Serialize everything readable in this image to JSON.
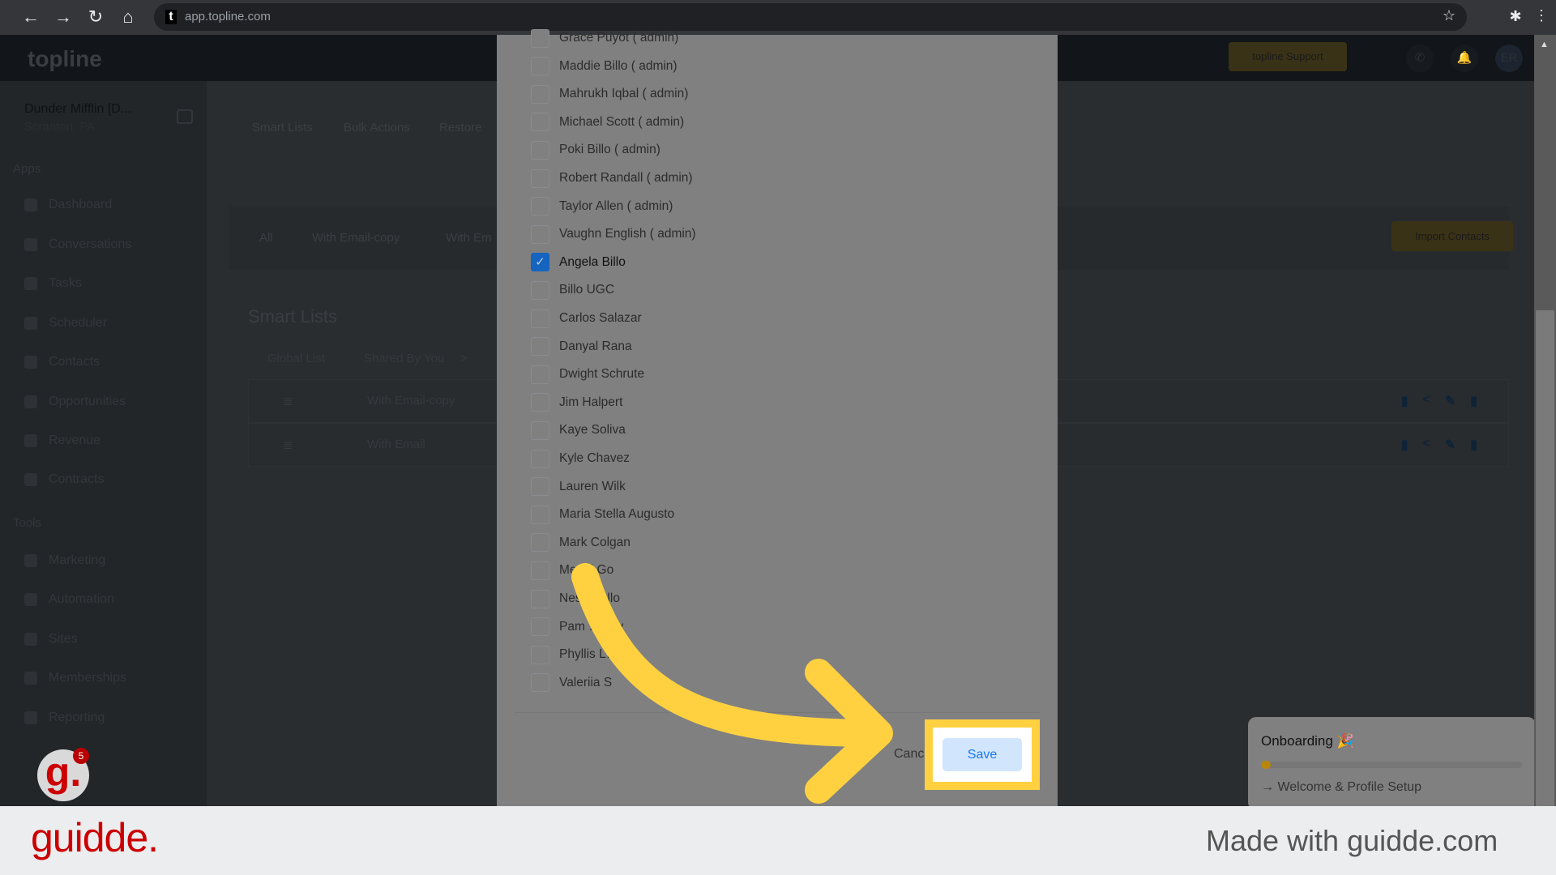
{
  "browser": {
    "url": "app.topline.com",
    "nav": [
      "back",
      "forward",
      "reload",
      "home"
    ]
  },
  "app": {
    "logo": "topline",
    "support_label": "topline Support",
    "avatar_initials": "ER"
  },
  "sidebar": {
    "account_name": "Dunder Mifflin [D...",
    "account_location": "Scranton, PA",
    "apps_heading": "Apps",
    "tools_heading": "Tools",
    "apps": [
      "Dashboard",
      "Conversations",
      "Tasks",
      "Scheduler",
      "Contacts",
      "Opportunities",
      "Revenue",
      "Contracts"
    ],
    "tools": [
      "Marketing",
      "Automation",
      "Sites",
      "Memberships",
      "Reporting"
    ]
  },
  "tabs": [
    "Smart Lists",
    "Bulk Actions",
    "Restore"
  ],
  "filters": [
    "All",
    "With Email-copy",
    "With Em"
  ],
  "import_label": "Import Contacts",
  "smart_lists": {
    "title": "Smart Lists",
    "crumbs": [
      "Global List",
      "Shared By You",
      ">"
    ],
    "rows": [
      "With Email-copy",
      "With Email"
    ]
  },
  "modal": {
    "users": [
      {
        "name": "Grace Puyot ( admin)",
        "checked": false
      },
      {
        "name": "Maddie Billo ( admin)",
        "checked": false
      },
      {
        "name": "Mahrukh Iqbal ( admin)",
        "checked": false
      },
      {
        "name": "Michael Scott ( admin)",
        "checked": false
      },
      {
        "name": "Poki Billo ( admin)",
        "checked": false
      },
      {
        "name": "Robert Randall ( admin)",
        "checked": false
      },
      {
        "name": "Taylor Allen ( admin)",
        "checked": false
      },
      {
        "name": "Vaughn English ( admin)",
        "checked": false
      },
      {
        "name": "Angela Billo",
        "checked": true
      },
      {
        "name": "Billo UGC",
        "checked": false
      },
      {
        "name": "Carlos Salazar",
        "checked": false
      },
      {
        "name": "Danyal Rana",
        "checked": false
      },
      {
        "name": "Dwight Schrute",
        "checked": false
      },
      {
        "name": "Jim Halpert",
        "checked": false
      },
      {
        "name": "Kaye Soliva",
        "checked": false
      },
      {
        "name": "Kyle Chavez",
        "checked": false
      },
      {
        "name": "Lauren Wilk",
        "checked": false
      },
      {
        "name": "Maria Stella Augusto",
        "checked": false
      },
      {
        "name": "Mark Colgan",
        "checked": false
      },
      {
        "name": "Merial Go",
        "checked": false
      },
      {
        "name": "Nes…sullo",
        "checked": false
      },
      {
        "name": "Pam …sley",
        "checked": false
      },
      {
        "name": "Phyllis L…",
        "checked": false
      },
      {
        "name": "Valeriia S",
        "checked": false
      }
    ],
    "cancel_label": "Cancel",
    "save_label": "Save"
  },
  "onboarding": {
    "title": "Onboarding",
    "step": "Welcome & Profile Setup",
    "progress_percent": 2
  },
  "guidde": {
    "badge_count": "5",
    "logo": "guidde.",
    "made_with": "Made with guidde.com"
  },
  "colors": {
    "highlight": "#ffd140",
    "save_bg": "#d1e6fc",
    "save_text": "#1877f2",
    "brand_red": "#cc0000"
  }
}
